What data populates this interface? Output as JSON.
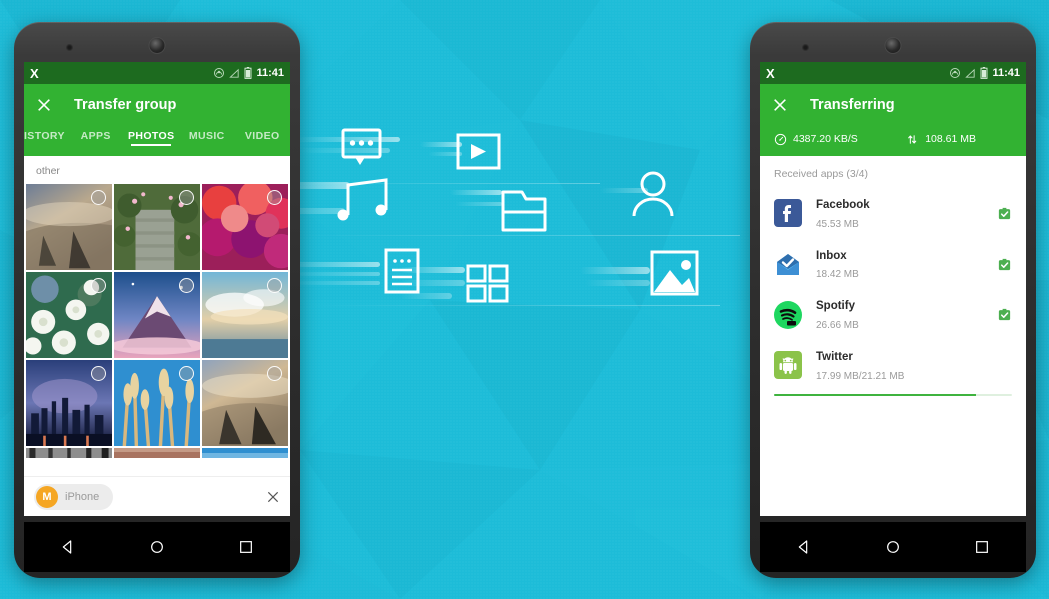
{
  "theme": {
    "background_cyan": "#1dbcd8",
    "header_green": "#32b232",
    "statusbar_green": "#1d6b1f",
    "accent_orange": "#f5a623",
    "progress_green": "#3fb33f"
  },
  "left_phone": {
    "statusbar": {
      "app_logo": "X",
      "time": "11:41",
      "icons": [
        "headset-icon",
        "signal-icon",
        "battery-icon"
      ]
    },
    "appbar": {
      "close_icon": "close-icon",
      "title": "Transfer group"
    },
    "tabs": [
      {
        "label": "HISTORY",
        "active": false
      },
      {
        "label": "APPS",
        "active": false
      },
      {
        "label": "PHOTOS",
        "active": true
      },
      {
        "label": "MUSIC",
        "active": false
      },
      {
        "label": "VIDEO",
        "active": false
      }
    ],
    "section_label": "other",
    "photos": [
      {
        "alt": "aerial-beach",
        "selected": false
      },
      {
        "alt": "flower-stairs",
        "selected": false
      },
      {
        "alt": "red-coral-flowers",
        "selected": false
      },
      {
        "alt": "white-blossoms",
        "selected": false
      },
      {
        "alt": "pink-mountain",
        "selected": false
      },
      {
        "alt": "sunset-clouds",
        "selected": false
      },
      {
        "alt": "night-city-skyline",
        "selected": false
      },
      {
        "alt": "golden-reeds",
        "selected": false
      },
      {
        "alt": "beach-driftwood",
        "selected": false
      }
    ],
    "bottom_bar": {
      "avatar_initial": "M",
      "device_name": "iPhone",
      "close_icon": "close-icon"
    },
    "navbar": [
      "back-icon",
      "home-icon",
      "recents-icon"
    ]
  },
  "right_phone": {
    "statusbar": {
      "app_logo": "X",
      "time": "11:41",
      "icons": [
        "headset-icon",
        "signal-icon",
        "battery-icon"
      ]
    },
    "appbar": {
      "close_icon": "close-icon",
      "title": "Transferring"
    },
    "stats": {
      "speed_icon": "speedometer-icon",
      "speed": "4387.20 KB/S",
      "size_icon": "transfer-arrows-icon",
      "size": "108.61 MB"
    },
    "received_label": "Received apps (3/4)",
    "apps": [
      {
        "name": "Facebook",
        "size": "45.53 MB",
        "icon": "facebook-icon",
        "status": "done",
        "progress": null
      },
      {
        "name": "Inbox",
        "size": "18.42 MB",
        "icon": "inbox-icon",
        "status": "done",
        "progress": null
      },
      {
        "name": "Spotify",
        "size": "26.66 MB",
        "icon": "spotify-icon",
        "status": "done",
        "progress": null
      },
      {
        "name": "Twitter",
        "size": "17.99 MB/21.21 MB",
        "icon": "android-placeholder-icon",
        "status": "transferring",
        "progress": 85
      }
    ],
    "navbar": [
      "back-icon",
      "home-icon",
      "recents-icon"
    ]
  },
  "center_art": {
    "icons": [
      "chat-bubble-icon",
      "video-play-icon",
      "music-note-icon",
      "folder-icon",
      "person-icon",
      "document-icon",
      "app-grid-icon",
      "image-icon"
    ]
  }
}
